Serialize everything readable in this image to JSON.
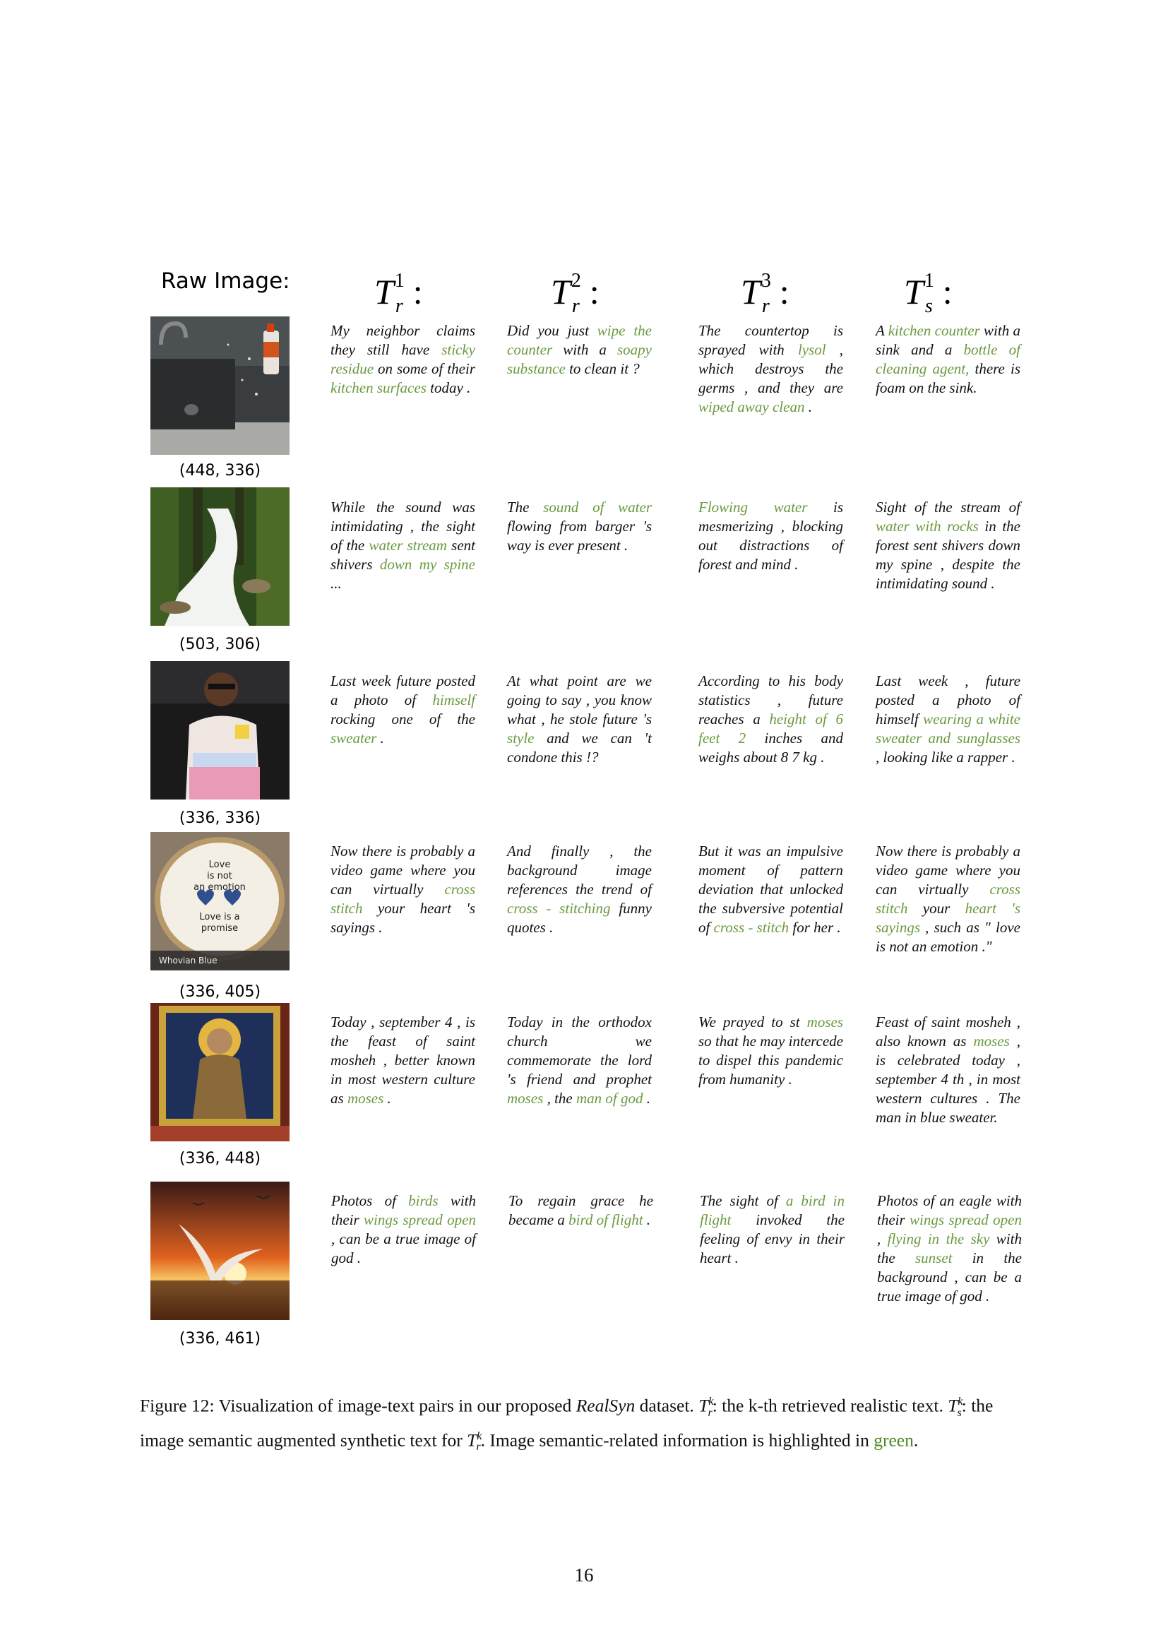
{
  "header": {
    "raw_image_label": "Raw Image:",
    "cols": [
      "T_r^1 :",
      "T_r^2 :",
      "T_r^3 :",
      "T_s^1 :"
    ]
  },
  "rows": [
    {
      "image_desc": "kitchen-sink",
      "size": "(448, 336)",
      "texts": [
        [
          [
            "My neighbor claims they still have ",
            false
          ],
          [
            "sticky residue",
            true
          ],
          [
            " on some of their ",
            false
          ],
          [
            "kitchen surfaces",
            true
          ],
          [
            " today .",
            false
          ]
        ],
        [
          [
            "Did you just ",
            false
          ],
          [
            "wipe the counter",
            true
          ],
          [
            " with a ",
            false
          ],
          [
            "soapy substance",
            true
          ],
          [
            " to clean it ?",
            false
          ]
        ],
        [
          [
            "The countertop is sprayed with ",
            false
          ],
          [
            "lysol",
            true
          ],
          [
            " , which destroys the germs , and they are ",
            false
          ],
          [
            "wiped away clean",
            true
          ],
          [
            " .",
            false
          ]
        ],
        [
          [
            "A ",
            false
          ],
          [
            "kitchen counter",
            true
          ],
          [
            " with a sink and a ",
            false
          ],
          [
            "bottle of cleaning agent,",
            true
          ],
          [
            " there is foam on the sink.",
            false
          ]
        ]
      ]
    },
    {
      "image_desc": "waterfall",
      "size": "(503, 306)",
      "texts": [
        [
          [
            "While the sound was intimidating , the sight of the ",
            false
          ],
          [
            "water stream",
            true
          ],
          [
            " sent shivers ",
            false
          ],
          [
            "down my spine",
            true
          ],
          [
            " ...",
            false
          ]
        ],
        [
          [
            "The ",
            false
          ],
          [
            "sound of water",
            true
          ],
          [
            " flowing from barger 's way is ever present .",
            false
          ]
        ],
        [
          [
            "Flowing water",
            true
          ],
          [
            " is mesmerizing , blocking out distractions of forest and mind .",
            false
          ]
        ],
        [
          [
            "Sight of the stream of ",
            false
          ],
          [
            "water with rocks",
            true
          ],
          [
            " in the forest sent shivers down my spine , despite the intimidating sound .",
            false
          ]
        ]
      ]
    },
    {
      "image_desc": "man-in-sweater",
      "size": "(336, 336)",
      "texts": [
        [
          [
            "Last week future posted a photo of ",
            false
          ],
          [
            "himself",
            true
          ],
          [
            " rocking one of the ",
            false
          ],
          [
            "sweater",
            true
          ],
          [
            " .",
            false
          ]
        ],
        [
          [
            "At what point are we going to say , you know what , he stole future 's ",
            false
          ],
          [
            "style",
            true
          ],
          [
            " and we can 't condone this !?",
            false
          ]
        ],
        [
          [
            "According to his body statistics , future reaches a ",
            false
          ],
          [
            "height of 6 feet 2",
            true
          ],
          [
            " inches and weighs about 8 7 kg .",
            false
          ]
        ],
        [
          [
            "Last week , future posted a photo of himself ",
            false
          ],
          [
            "wearing a white sweater and sunglasses",
            true
          ],
          [
            " , looking like a rapper .",
            false
          ]
        ]
      ]
    },
    {
      "image_desc": "cross-stitch",
      "size": "(336, 405)",
      "texts": [
        [
          [
            "Now there is probably a video game where you can virtually ",
            false
          ],
          [
            "cross stitch",
            true
          ],
          [
            " your heart 's sayings .",
            false
          ]
        ],
        [
          [
            "And finally , the background image references the trend of ",
            false
          ],
          [
            "cross - stitching",
            true
          ],
          [
            " funny quotes .",
            false
          ]
        ],
        [
          [
            "But it was an impulsive moment of pattern deviation that unlocked the subversive potential of ",
            false
          ],
          [
            "cross - stitch",
            true
          ],
          [
            " for her .",
            false
          ]
        ],
        [
          [
            "Now there is probably a video game where you can virtually ",
            false
          ],
          [
            "cross stitch",
            true
          ],
          [
            " your ",
            false
          ],
          [
            "heart 's sayings",
            true
          ],
          [
            " , such as \" love is not an emotion .\"",
            false
          ]
        ]
      ]
    },
    {
      "image_desc": "icon-saint",
      "size": "(336, 448)",
      "texts": [
        [
          [
            "Today , september 4 , is the feast of saint mosheh , better known in most western culture as ",
            false
          ],
          [
            "moses",
            true
          ],
          [
            " .",
            false
          ]
        ],
        [
          [
            "Today in the orthodox church we commemorate the lord 's friend and prophet ",
            false
          ],
          [
            "moses",
            true
          ],
          [
            " , the ",
            false
          ],
          [
            "man of god",
            true
          ],
          [
            " .",
            false
          ]
        ],
        [
          [
            "We prayed to st ",
            false
          ],
          [
            "moses",
            true
          ],
          [
            " so that he may intercede to dispel this pandemic from humanity .",
            false
          ]
        ],
        [
          [
            "Feast of saint mosheh , also known as ",
            false
          ],
          [
            "moses",
            true
          ],
          [
            " , is celebrated today , september 4 th , in most western cultures .  The man in blue sweater.",
            false
          ]
        ]
      ]
    },
    {
      "image_desc": "bird-sunset",
      "size": "(336, 461)",
      "texts": [
        [
          [
            "Photos of ",
            false
          ],
          [
            "birds",
            true
          ],
          [
            " with their ",
            false
          ],
          [
            "wings spread open",
            true
          ],
          [
            " , can be a true image of god .",
            false
          ]
        ],
        [
          [
            "To regain grace he became a ",
            false
          ],
          [
            "bird of flight",
            true
          ],
          [
            " .",
            false
          ]
        ],
        [
          [
            "The sight of ",
            false
          ],
          [
            "a bird in flight",
            true
          ],
          [
            " invoked the feeling of envy in their heart .",
            false
          ]
        ],
        [
          [
            "Photos of an eagle with their ",
            false
          ],
          [
            "wings spread open",
            true
          ],
          [
            " , ",
            false
          ],
          [
            "flying in the sky",
            true
          ],
          [
            " with the ",
            false
          ],
          [
            "sunset",
            true
          ],
          [
            " in the background , can be a true image of god .",
            false
          ]
        ]
      ]
    }
  ],
  "caption": {
    "label": "Figure 12:",
    "part1": "Visualization of image-text pairs in our proposed",
    "dataset": "RealSyn",
    "part2": "dataset.",
    "tr_desc": ": the k-th retrieved realistic text.",
    "ts_desc": ": the image semantic augmented synthetic text for",
    "part3": ". Image semantic-related information is highlighted in",
    "green_word": "green",
    "end": "."
  },
  "page_number": "16",
  "colors": {
    "highlight": "#6a9a3f",
    "text": "#111111"
  }
}
